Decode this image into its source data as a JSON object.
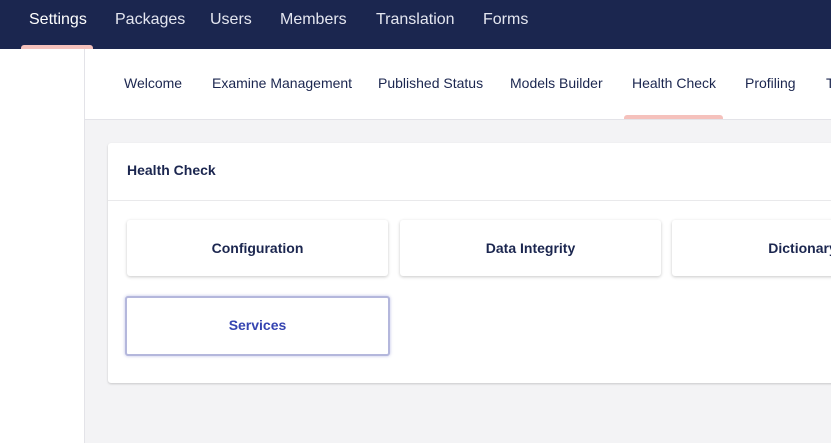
{
  "topnav": {
    "items": [
      "Settings",
      "Packages",
      "Users",
      "Members",
      "Translation",
      "Forms"
    ],
    "active": "Settings"
  },
  "subtabs": {
    "items": [
      "Welcome",
      "Examine Management",
      "Published Status",
      "Models Builder",
      "Health Check",
      "Profiling",
      "T"
    ],
    "active": "Health Check"
  },
  "panel": {
    "title": "Health Check",
    "groups": [
      "Configuration",
      "Data Integrity",
      "Dictionary",
      "Services"
    ],
    "focused": "Services"
  },
  "colors": {
    "header_bg": "#1b264f",
    "active_indicator": "#f5c1bc",
    "focus_text": "#3544b1"
  }
}
